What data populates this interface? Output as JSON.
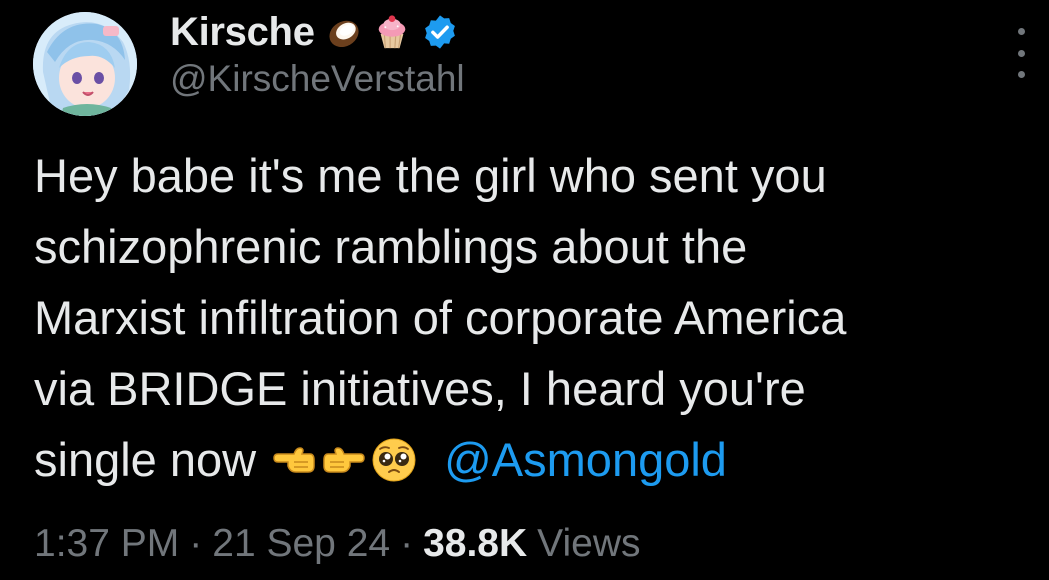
{
  "author": {
    "display_name": "Kirsche",
    "handle": "@KirscheVerstahl",
    "name_emojis": [
      "coconut-emoji",
      "cupcake-emoji"
    ],
    "verified": true
  },
  "tweet": {
    "lines": [
      "Hey babe it's me the girl who sent you",
      "schizophrenic ramblings about the",
      "Marxist infiltration of corporate America",
      "via BRIDGE initiatives, I heard you're",
      "single now"
    ],
    "emojis": [
      "backhand-index-pointing-left-emoji",
      "backhand-index-pointing-right-emoji",
      "pleading-face-emoji"
    ],
    "mention": "@Asmongold"
  },
  "meta": {
    "time": "1:37 PM",
    "separator": "·",
    "date": "21 Sep 24",
    "views_count": "38.8K",
    "views_label": "Views"
  },
  "colors": {
    "background": "#000000",
    "text": "#e7e9ea",
    "secondary": "#71767b",
    "accent": "#1d9bf0"
  }
}
